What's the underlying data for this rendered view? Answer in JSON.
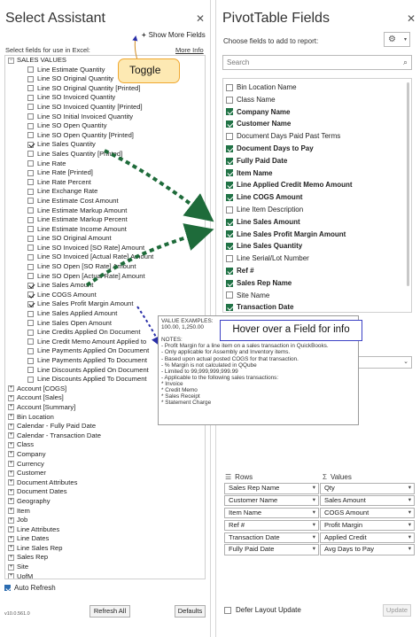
{
  "left_panel": {
    "title": "Select Assistant",
    "close_icon": "close-icon",
    "show_more_fields": "Show More Fields",
    "fields_label": "Select fields for use in Excel:",
    "more_info": "More Info",
    "root_label": "SALES VALUES",
    "sub_items": [
      {
        "label": "Line Estimate Quantity",
        "checked": false
      },
      {
        "label": "Line SO Original Quantity",
        "checked": false
      },
      {
        "label": "Line SO Original Quantity [Printed]",
        "checked": false
      },
      {
        "label": "Line SO Invoiced Quantity",
        "checked": false
      },
      {
        "label": "Line SO Invoiced Quantity [Printed]",
        "checked": false
      },
      {
        "label": "Line SO Initial Invoiced Quantity",
        "checked": false
      },
      {
        "label": "Line SO Open Quantity",
        "checked": false
      },
      {
        "label": "Line SO Open Quantity [Printed]",
        "checked": false
      },
      {
        "label": "Line Sales Quantity",
        "checked": true
      },
      {
        "label": "Line Sales Quantity [Printed]",
        "checked": false
      },
      {
        "label": "Line Rate",
        "checked": false
      },
      {
        "label": "Line Rate [Printed]",
        "checked": false
      },
      {
        "label": "Line Rate Percent",
        "checked": false
      },
      {
        "label": "Line Exchange Rate",
        "checked": false
      },
      {
        "label": "Line Estimate Cost Amount",
        "checked": false
      },
      {
        "label": "Line Estimate Markup Amount",
        "checked": false
      },
      {
        "label": "Line Estimate Markup Percent",
        "checked": false
      },
      {
        "label": "Line Estimate Income Amount",
        "checked": false
      },
      {
        "label": "Line SO Original Amount",
        "checked": false
      },
      {
        "label": "Line SO Invoiced [SO Rate] Amount",
        "checked": false
      },
      {
        "label": "Line SO Invoiced [Actual Rate] Amount",
        "checked": false
      },
      {
        "label": "Line SO Open [SO Rate] Amount",
        "checked": false
      },
      {
        "label": "Line SO Open [Actual Rate] Amount",
        "checked": false
      },
      {
        "label": "Line Sales Amount",
        "checked": true
      },
      {
        "label": "Line COGS Amount",
        "checked": true
      },
      {
        "label": "Line Sales Profit Margin Amount",
        "checked": true
      },
      {
        "label": "Line Sales Applied Amount",
        "checked": false
      },
      {
        "label": "Line Sales Open Amount",
        "checked": false
      },
      {
        "label": "Line Credits Applied On Document",
        "checked": false
      },
      {
        "label": "Line Credit Memo Amount Applied to",
        "checked": false
      },
      {
        "label": "Line Payments Applied On Document",
        "checked": false
      },
      {
        "label": "Line Payments Applied To Document",
        "checked": false
      },
      {
        "label": "Line Discounts Applied On Document",
        "checked": false
      },
      {
        "label": "Line Discounts Applied To Document",
        "checked": false
      }
    ],
    "top_items": [
      "Account [COGS]",
      "Account [Sales]",
      "Account [Summary]",
      "Bin Location",
      "Calendar - Fully Paid Date",
      "Calendar - Transaction Date",
      "Class",
      "Company",
      "Currency",
      "Customer",
      "Document Attributes",
      "Document Dates",
      "Geography",
      "Item",
      "Job",
      "Line Attributes",
      "Line Dates",
      "Line Sales Rep",
      "Sales Rep",
      "Site",
      "UofM"
    ],
    "auto_refresh": "Auto Refresh",
    "version": "v10.0.561.0",
    "refresh_all": "Refresh All",
    "defaults": "Defaults"
  },
  "right_panel": {
    "title": "PivotTable Fields",
    "close_icon": "close-icon",
    "choose_label": "Choose fields to add to report:",
    "search_placeholder": "Search",
    "fields": [
      {
        "label": "Bin Location Name",
        "checked": false
      },
      {
        "label": "Class Name",
        "checked": false
      },
      {
        "label": "Company Name",
        "checked": true
      },
      {
        "label": "Customer Name",
        "checked": true
      },
      {
        "label": "Document Days Paid Past Terms",
        "checked": false
      },
      {
        "label": "Document Days to Pay",
        "checked": true
      },
      {
        "label": "Fully Paid Date",
        "checked": true
      },
      {
        "label": "Item Name",
        "checked": true
      },
      {
        "label": "Line Applied Credit Memo Amount",
        "checked": true
      },
      {
        "label": "Line COGS Amount",
        "checked": true
      },
      {
        "label": "Line Item Description",
        "checked": false
      },
      {
        "label": "Line Sales Amount",
        "checked": true
      },
      {
        "label": "Line Sales Profit Margin Amount",
        "checked": true
      },
      {
        "label": "Line Sales Quantity",
        "checked": true
      },
      {
        "label": "Line Serial/Lot Number",
        "checked": false
      },
      {
        "label": "Ref #",
        "checked": true
      },
      {
        "label": "Sales Rep Name",
        "checked": true
      },
      {
        "label": "Site Name",
        "checked": false
      },
      {
        "label": "Transaction Date",
        "checked": true
      }
    ],
    "rows_label": "Rows",
    "values_label": "Values",
    "rows": [
      "Sales Rep Name",
      "Customer Name",
      "Item Name",
      "Ref #",
      "Transaction Date",
      "Fully Paid Date"
    ],
    "values": [
      "Qty",
      "Sales Amount",
      "COGS Amount",
      "Profit Margin",
      "Applied Credit",
      "Avg Days to Pay"
    ],
    "defer_layout": "Defer Layout Update",
    "update": "Update"
  },
  "callouts": {
    "toggle": "Toggle",
    "hover": "Hover over a Field for info"
  },
  "tooltip": {
    "lines": [
      "VALUE EXAMPLES:",
      "100.00, 1,250.00",
      "",
      "NOTES:",
      "- Profit Margin for a line item on a sales transaction in QuickBooks.",
      "- Only applicable for Assembly and Inventory items.",
      "- Based upon actual posted COGS for that transaction.",
      "- % Margin is not calculated in QQube",
      "- Limited to 99,999,999,999.99",
      "- Applicable to the following sales transactions:",
      "  * Invoice",
      "  * Credit Memo",
      "  * Sales Receipt",
      "  * Statement Charge"
    ]
  },
  "colors": {
    "excel_green": "#217346",
    "toggle_fill": "#fde9b3",
    "toggle_border": "#f0a830",
    "arrow_green": "#1e6b3a",
    "hover_border": "#3b41c4"
  }
}
